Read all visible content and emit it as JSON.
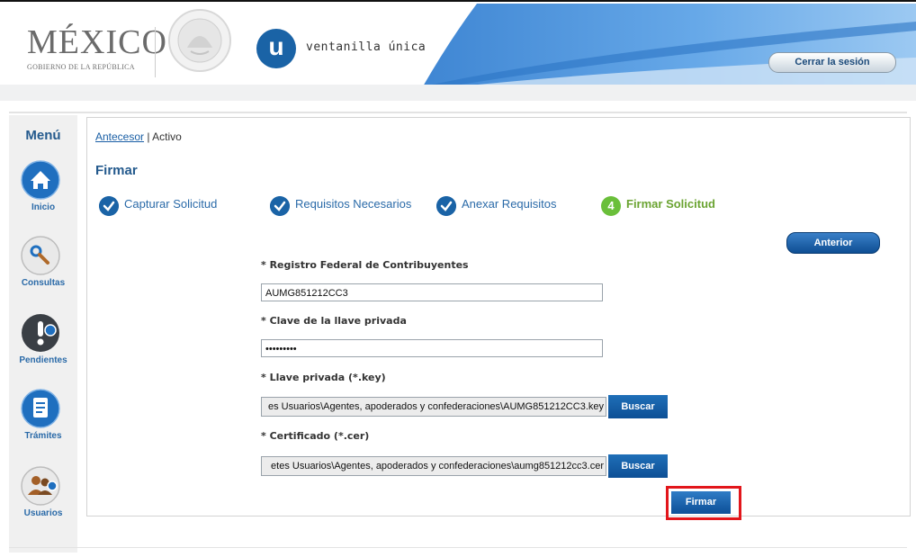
{
  "header": {
    "logo_main": "MÉXICO",
    "logo_sub": "GOBIERNO DE LA REPÚBLICA",
    "vu_letter": "u",
    "vu_name": "ventanilla única",
    "logout_label": "Cerrar la sesión"
  },
  "sidebar": {
    "title": "Menú",
    "items": [
      {
        "label": "Inicio",
        "icon": "home-icon"
      },
      {
        "label": "Consultas",
        "icon": "binoculars-icon"
      },
      {
        "label": "Pendientes",
        "icon": "exclamation-icon"
      },
      {
        "label": "Trámites",
        "icon": "document-icon"
      },
      {
        "label": "Usuarios",
        "icon": "users-icon"
      }
    ]
  },
  "breadcrumb": {
    "link": "Antecesor",
    "separator": "|",
    "current": "Activo"
  },
  "page_title": "Firmar",
  "steps": [
    {
      "label": "Capturar Solicitud",
      "state": "done"
    },
    {
      "label": "Requisitos Necesarios",
      "state": "done"
    },
    {
      "label": "Anexar Requisitos",
      "state": "done"
    },
    {
      "label": "Firmar Solicitud",
      "state": "current",
      "number": "4"
    }
  ],
  "anterior_label": "Anterior",
  "form": {
    "rfc_label": "* Registro Federal de Contribuyentes",
    "rfc_value": "AUMG851212CC3",
    "clave_label": "* Clave de la llave privada",
    "clave_value": "•••••••••",
    "key_label": "* Llave privada (*.key)",
    "key_value": "es Usuarios\\Agentes, apoderados y confederaciones\\AUMG851212CC3.key",
    "cer_label": "* Certificado (*.cer)",
    "cer_value": "etes Usuarios\\Agentes, apoderados y confederaciones\\aumg851212cc3.cer",
    "buscar_label": "Buscar",
    "firmar_label": "Firmar"
  },
  "colors": {
    "brand_blue": "#1a63a6",
    "step_current_green": "#6abf3a",
    "highlight_red": "#e2161b"
  }
}
